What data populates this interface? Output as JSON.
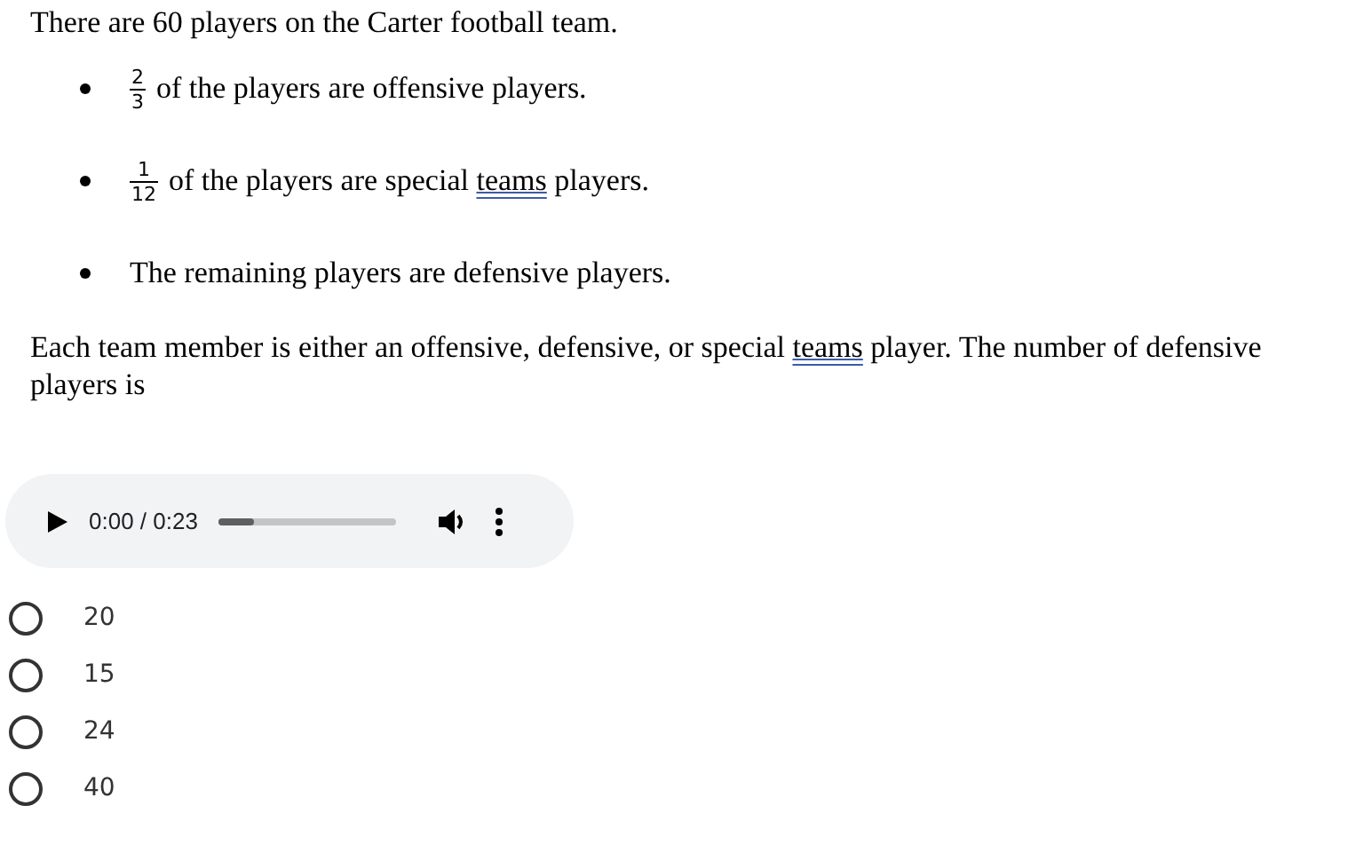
{
  "intro": "There are 60 players on the Carter football team.",
  "bullets": [
    {
      "kind": "fraction",
      "numerator": "2",
      "denominator": "3",
      "before": "of the players are offensive players."
    },
    {
      "kind": "fraction",
      "numerator": "1",
      "denominator": "12",
      "before": "of the players are special ",
      "underlined": "teams",
      "after": " players."
    },
    {
      "kind": "text",
      "before": "The remaining players are defensive players."
    }
  ],
  "question": {
    "before": "Each team member is either an offensive, defensive, or special ",
    "underlined": "teams",
    "after": " player.  The number of defensive players is"
  },
  "audio": {
    "time": "0:00 / 0:23",
    "level": 0.2
  },
  "options": [
    {
      "label": "20",
      "selected": false
    },
    {
      "label": "15",
      "selected": false
    },
    {
      "label": "24",
      "selected": false
    },
    {
      "label": "40",
      "selected": false
    }
  ]
}
